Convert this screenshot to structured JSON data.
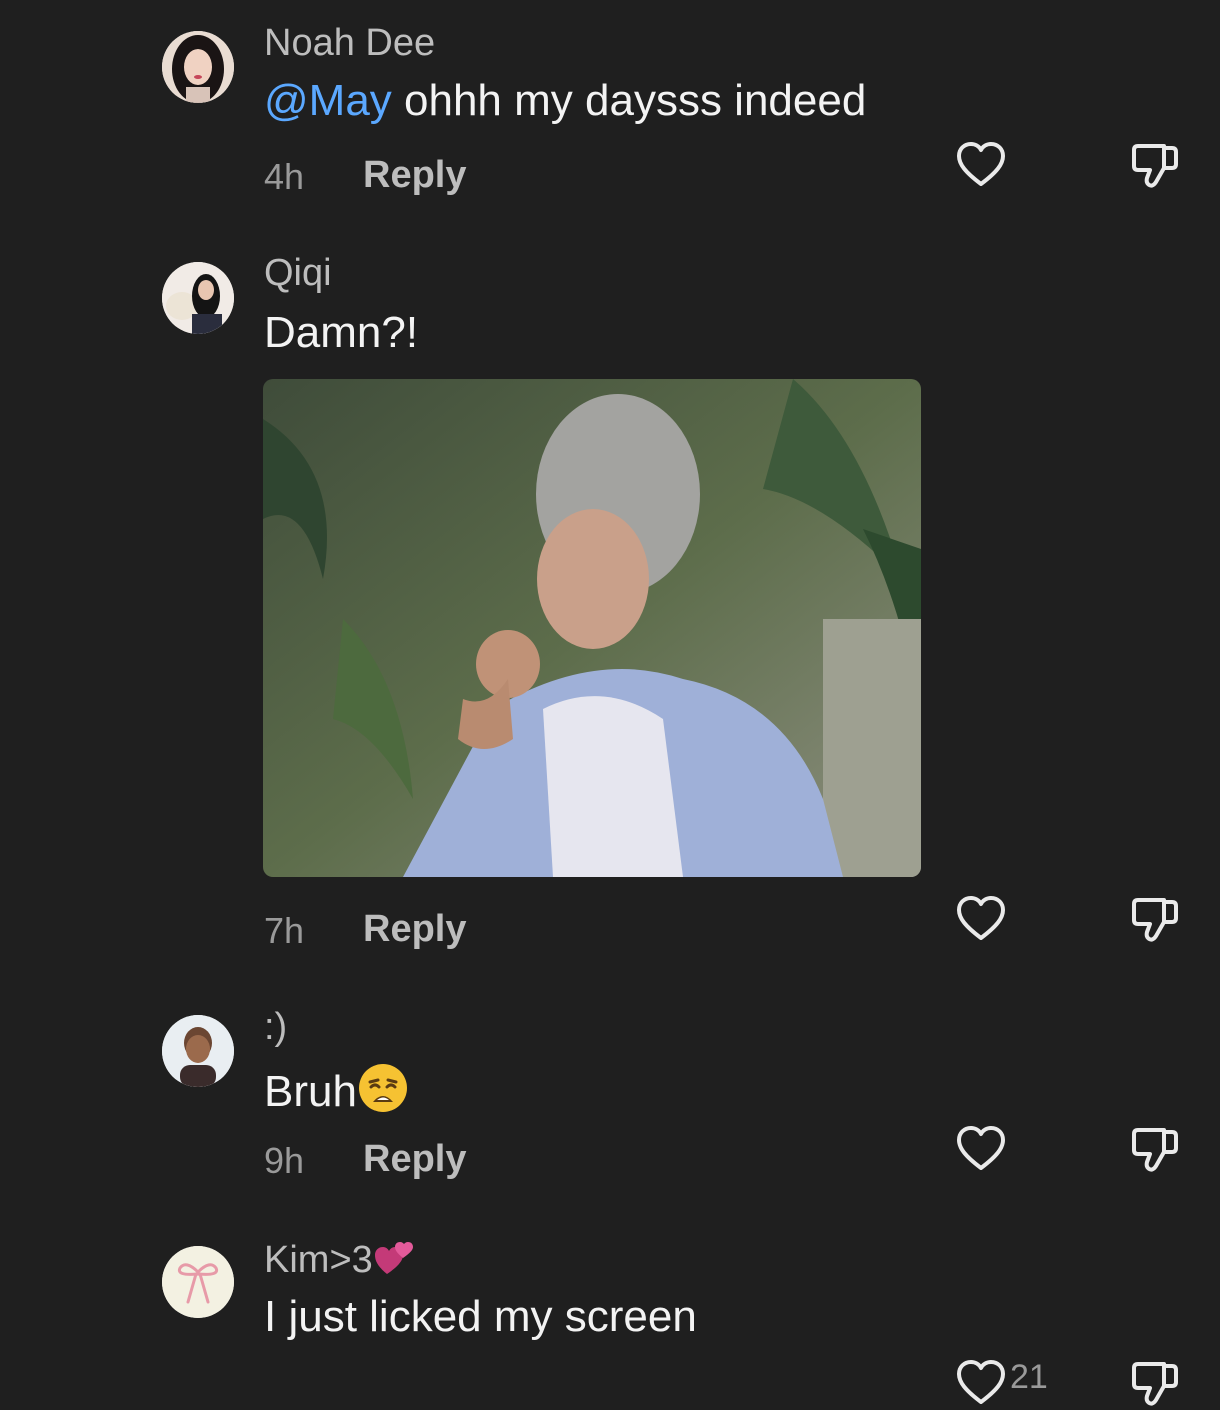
{
  "comments": [
    {
      "username": "Noah Dee",
      "mention": "@May",
      "text": " ohhh my daysss indeed",
      "time": "4h",
      "reply_label": "Reply"
    },
    {
      "username": "Qiqi",
      "text": "Damn?!",
      "time": "7h",
      "reply_label": "Reply",
      "media": "gif-elderly-woman-coughing"
    },
    {
      "username": ":)",
      "text": "Bruh",
      "emoji": "weary-face",
      "time": "9h",
      "reply_label": "Reply"
    },
    {
      "username": "Kim>3",
      "username_emoji": "revolving-hearts",
      "text": "I just licked my screen",
      "like_count_partial": "21"
    }
  ],
  "colors": {
    "background": "#1f1f1f",
    "mention": "#5ba8ff",
    "username": "#bdbdbd",
    "meta": "#9a9a9a"
  }
}
